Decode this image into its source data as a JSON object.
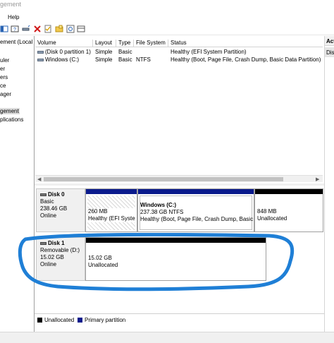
{
  "window": {
    "title": "gement"
  },
  "menu": {
    "help": "Help"
  },
  "toolbar": {
    "icons": [
      "back-icon",
      "forward-icon",
      "show-hide-tree-icon",
      "help-icon",
      "connect-drive-icon",
      "delete-icon",
      "properties-icon",
      "folder-icon",
      "search-icon",
      "view-icon"
    ]
  },
  "tree": {
    "items": [
      "ement (Local",
      "uler",
      "er",
      "ers",
      "ce",
      "ager",
      "gement",
      "plications"
    ],
    "selected_index": 6
  },
  "volume_table": {
    "columns": [
      "Volume",
      "Layout",
      "Type",
      "File System",
      "Status"
    ],
    "rows": [
      {
        "volume": "(Disk 0 partition 1)",
        "layout": "Simple",
        "type": "Basic",
        "file_system": "",
        "status": "Healthy (EFI System Partition)"
      },
      {
        "volume": "Windows (C:)",
        "layout": "Simple",
        "type": "Basic",
        "file_system": "NTFS",
        "status": "Healthy (Boot, Page File, Crash Dump, Basic Data Partition)"
      }
    ]
  },
  "disks": [
    {
      "name": "Disk 0",
      "type": "Basic",
      "size": "238.46 GB",
      "state": "Online",
      "partitions": [
        {
          "label": "",
          "size": "260 MB",
          "detail": "Healthy (EFI Syste",
          "kind": "primary",
          "hatched": true
        },
        {
          "label": "Windows  (C:)",
          "size": "237.38 GB NTFS",
          "detail": "Healthy (Boot, Page File, Crash Dump, Basic",
          "kind": "primary",
          "hatched": false
        },
        {
          "label": "",
          "size": "848 MB",
          "detail": "Unallocated",
          "kind": "unallocated",
          "hatched": false
        }
      ]
    },
    {
      "name": "Disk 1",
      "type": "Removable (D:)",
      "size": "15.02 GB",
      "state": "Online",
      "partitions": [
        {
          "label": "",
          "size": "15.02 GB",
          "detail": "Unallocated",
          "kind": "unallocated",
          "hatched": false
        }
      ]
    }
  ],
  "legend": {
    "unallocated": "Unallocated",
    "primary": "Primary partition"
  },
  "actions": {
    "header": "Acti",
    "sub": "Dis"
  },
  "colors": {
    "primary": "#0a1a8c",
    "unallocated": "#000000",
    "annotation": "#1f7fd6"
  }
}
